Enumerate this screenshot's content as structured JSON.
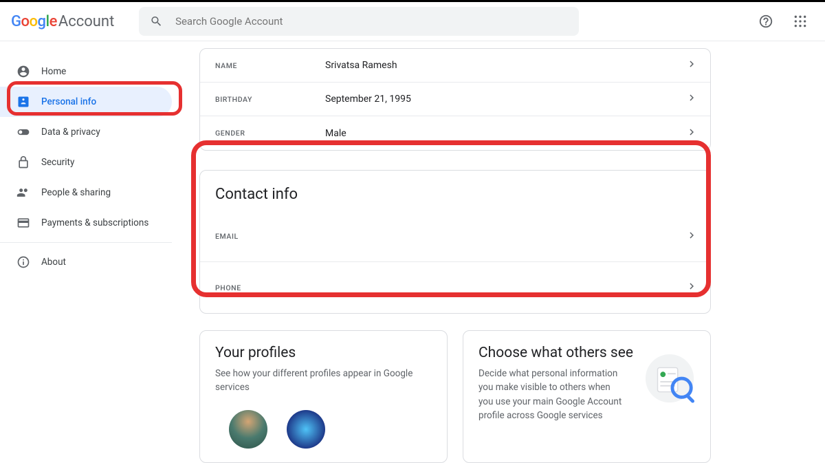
{
  "header": {
    "logo_account": "Account",
    "search_placeholder": "Search Google Account"
  },
  "sidebar": {
    "items": [
      {
        "label": "Home"
      },
      {
        "label": "Personal info"
      },
      {
        "label": "Data & privacy"
      },
      {
        "label": "Security"
      },
      {
        "label": "People & sharing"
      },
      {
        "label": "Payments & subscriptions"
      }
    ],
    "about": "About"
  },
  "basic_info": {
    "rows": [
      {
        "key": "NAME",
        "value": "Srivatsa Ramesh"
      },
      {
        "key": "BIRTHDAY",
        "value": "September 21, 1995"
      },
      {
        "key": "GENDER",
        "value": "Male"
      }
    ]
  },
  "contact_info": {
    "title": "Contact info",
    "rows": [
      {
        "key": "EMAIL",
        "value": ""
      },
      {
        "key": "PHONE",
        "value": ""
      }
    ]
  },
  "profiles": {
    "title": "Your profiles",
    "desc": "See how your different profiles appear in Google services"
  },
  "choose": {
    "title": "Choose what others see",
    "desc": "Decide what personal information you make visible to others when you use your main Google Account profile across Google services"
  }
}
